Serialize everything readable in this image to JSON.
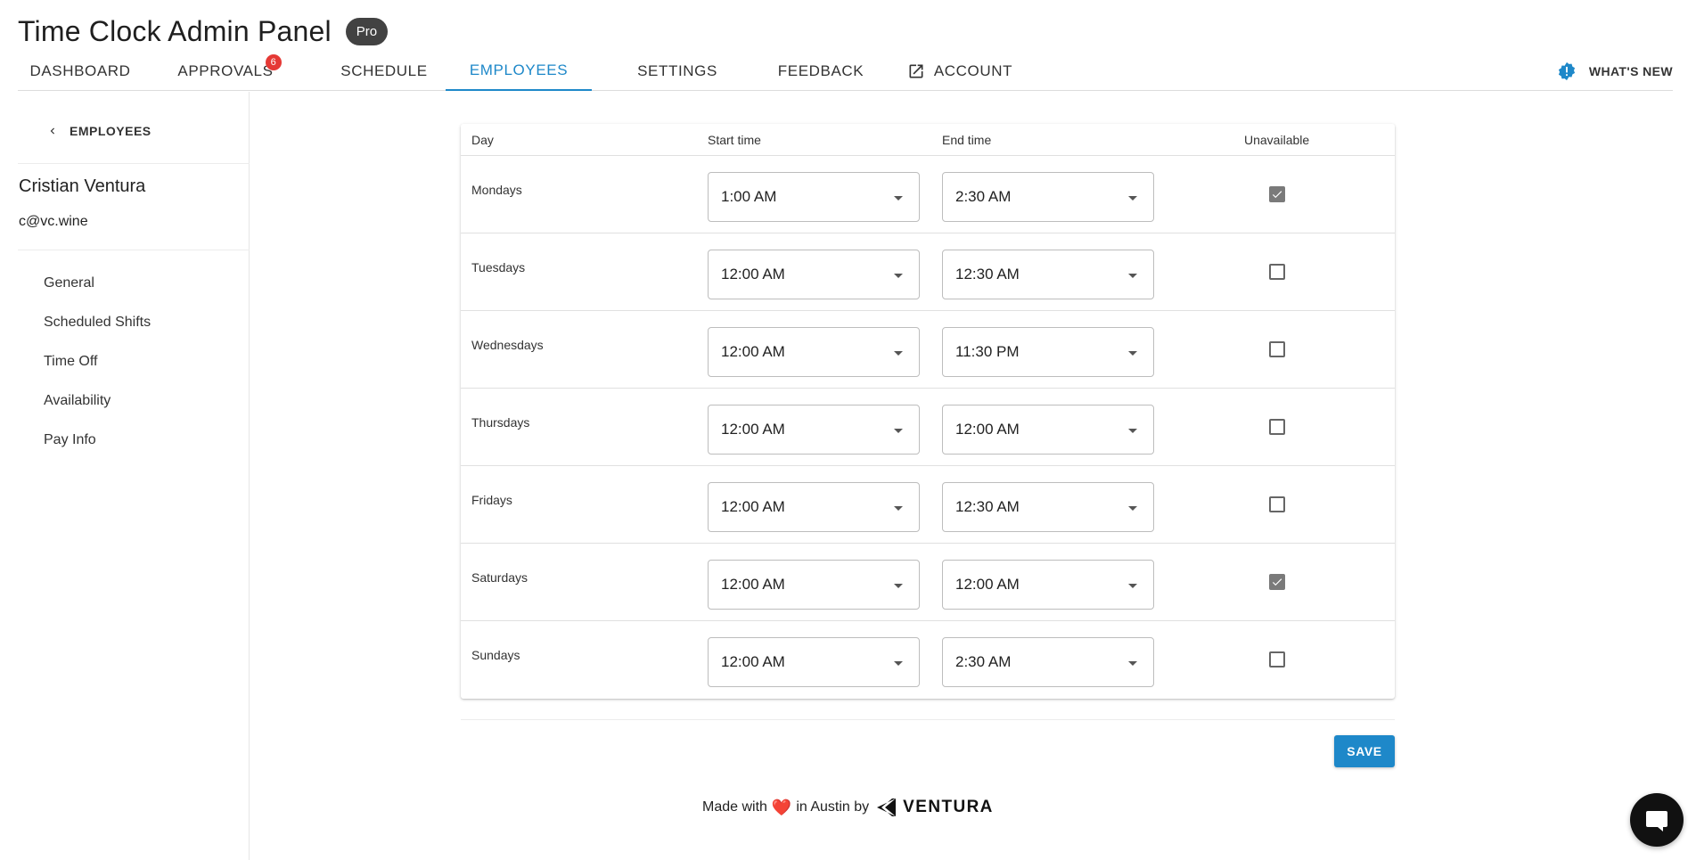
{
  "app": {
    "title": "Time Clock Admin Panel",
    "badge": "Pro"
  },
  "nav": {
    "tabs": [
      {
        "label": "DASHBOARD"
      },
      {
        "label": "APPROVALS",
        "count": "6"
      },
      {
        "label": "SCHEDULE"
      },
      {
        "label": "EMPLOYEES",
        "active": true
      },
      {
        "label": "SETTINGS"
      },
      {
        "label": "FEEDBACK"
      },
      {
        "label": "ACCOUNT",
        "icon": "external-link-icon"
      }
    ],
    "whats_new": {
      "label": "WHAT'S NEW",
      "icon": "alert-badge-icon"
    }
  },
  "sidebar": {
    "back_label": "EMPLOYEES",
    "employee_name": "Cristian Ventura",
    "employee_email": "c@vc.wine",
    "items": [
      {
        "label": "General"
      },
      {
        "label": "Scheduled Shifts"
      },
      {
        "label": "Time Off"
      },
      {
        "label": "Availability"
      },
      {
        "label": "Pay Info"
      }
    ]
  },
  "table": {
    "headers": {
      "day": "Day",
      "start": "Start time",
      "end": "End time",
      "unavailable": "Unavailable"
    },
    "rows": [
      {
        "day": "Mondays",
        "start": "1:00 AM",
        "end": "2:30 AM",
        "unavailable": true
      },
      {
        "day": "Tuesdays",
        "start": "12:00 AM",
        "end": "12:30 AM",
        "unavailable": false
      },
      {
        "day": "Wednesdays",
        "start": "12:00 AM",
        "end": "11:30 PM",
        "unavailable": false
      },
      {
        "day": "Thursdays",
        "start": "12:00 AM",
        "end": "12:00 AM",
        "unavailable": false
      },
      {
        "day": "Fridays",
        "start": "12:00 AM",
        "end": "12:30 AM",
        "unavailable": false
      },
      {
        "day": "Saturdays",
        "start": "12:00 AM",
        "end": "12:00 AM",
        "unavailable": true
      },
      {
        "day": "Sundays",
        "start": "12:00 AM",
        "end": "2:30 AM",
        "unavailable": false
      }
    ]
  },
  "actions": {
    "save_label": "SAVE"
  },
  "footer": {
    "made_with": "Made with",
    "heart": "❤️",
    "in_austin": "in Austin by",
    "brand": "VENTURA"
  },
  "colors": {
    "accent": "#1e88c9",
    "badge": "#e53935",
    "pro_badge": "#424242",
    "checked": "#7a7a7a"
  },
  "icons": {
    "chat": "chat-bubble-icon",
    "back": "chevron-left-icon",
    "dropdown": "caret-down-icon",
    "logo": "ventura-logo-icon"
  }
}
